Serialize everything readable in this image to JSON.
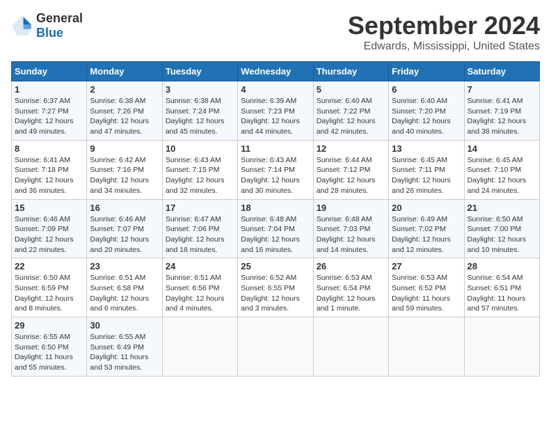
{
  "header": {
    "logo_general": "General",
    "logo_blue": "Blue",
    "month_title": "September 2024",
    "location": "Edwards, Mississippi, United States"
  },
  "days_of_week": [
    "Sunday",
    "Monday",
    "Tuesday",
    "Wednesday",
    "Thursday",
    "Friday",
    "Saturday"
  ],
  "weeks": [
    [
      {
        "day": "1",
        "sunrise": "6:37 AM",
        "sunset": "7:27 PM",
        "daylight": "12 hours and 49 minutes."
      },
      {
        "day": "2",
        "sunrise": "6:38 AM",
        "sunset": "7:26 PM",
        "daylight": "12 hours and 47 minutes."
      },
      {
        "day": "3",
        "sunrise": "6:38 AM",
        "sunset": "7:24 PM",
        "daylight": "12 hours and 45 minutes."
      },
      {
        "day": "4",
        "sunrise": "6:39 AM",
        "sunset": "7:23 PM",
        "daylight": "12 hours and 44 minutes."
      },
      {
        "day": "5",
        "sunrise": "6:40 AM",
        "sunset": "7:22 PM",
        "daylight": "12 hours and 42 minutes."
      },
      {
        "day": "6",
        "sunrise": "6:40 AM",
        "sunset": "7:20 PM",
        "daylight": "12 hours and 40 minutes."
      },
      {
        "day": "7",
        "sunrise": "6:41 AM",
        "sunset": "7:19 PM",
        "daylight": "12 hours and 38 minutes."
      }
    ],
    [
      {
        "day": "8",
        "sunrise": "6:41 AM",
        "sunset": "7:18 PM",
        "daylight": "12 hours and 36 minutes."
      },
      {
        "day": "9",
        "sunrise": "6:42 AM",
        "sunset": "7:16 PM",
        "daylight": "12 hours and 34 minutes."
      },
      {
        "day": "10",
        "sunrise": "6:43 AM",
        "sunset": "7:15 PM",
        "daylight": "12 hours and 32 minutes."
      },
      {
        "day": "11",
        "sunrise": "6:43 AM",
        "sunset": "7:14 PM",
        "daylight": "12 hours and 30 minutes."
      },
      {
        "day": "12",
        "sunrise": "6:44 AM",
        "sunset": "7:12 PM",
        "daylight": "12 hours and 28 minutes."
      },
      {
        "day": "13",
        "sunrise": "6:45 AM",
        "sunset": "7:11 PM",
        "daylight": "12 hours and 26 minutes."
      },
      {
        "day": "14",
        "sunrise": "6:45 AM",
        "sunset": "7:10 PM",
        "daylight": "12 hours and 24 minutes."
      }
    ],
    [
      {
        "day": "15",
        "sunrise": "6:46 AM",
        "sunset": "7:09 PM",
        "daylight": "12 hours and 22 minutes."
      },
      {
        "day": "16",
        "sunrise": "6:46 AM",
        "sunset": "7:07 PM",
        "daylight": "12 hours and 20 minutes."
      },
      {
        "day": "17",
        "sunrise": "6:47 AM",
        "sunset": "7:06 PM",
        "daylight": "12 hours and 18 minutes."
      },
      {
        "day": "18",
        "sunrise": "6:48 AM",
        "sunset": "7:04 PM",
        "daylight": "12 hours and 16 minutes."
      },
      {
        "day": "19",
        "sunrise": "6:48 AM",
        "sunset": "7:03 PM",
        "daylight": "12 hours and 14 minutes."
      },
      {
        "day": "20",
        "sunrise": "6:49 AM",
        "sunset": "7:02 PM",
        "daylight": "12 hours and 12 minutes."
      },
      {
        "day": "21",
        "sunrise": "6:50 AM",
        "sunset": "7:00 PM",
        "daylight": "12 hours and 10 minutes."
      }
    ],
    [
      {
        "day": "22",
        "sunrise": "6:50 AM",
        "sunset": "6:59 PM",
        "daylight": "12 hours and 8 minutes."
      },
      {
        "day": "23",
        "sunrise": "6:51 AM",
        "sunset": "6:58 PM",
        "daylight": "12 hours and 6 minutes."
      },
      {
        "day": "24",
        "sunrise": "6:51 AM",
        "sunset": "6:56 PM",
        "daylight": "12 hours and 4 minutes."
      },
      {
        "day": "25",
        "sunrise": "6:52 AM",
        "sunset": "6:55 PM",
        "daylight": "12 hours and 3 minutes."
      },
      {
        "day": "26",
        "sunrise": "6:53 AM",
        "sunset": "6:54 PM",
        "daylight": "12 hours and 1 minute."
      },
      {
        "day": "27",
        "sunrise": "6:53 AM",
        "sunset": "6:52 PM",
        "daylight": "11 hours and 59 minutes."
      },
      {
        "day": "28",
        "sunrise": "6:54 AM",
        "sunset": "6:51 PM",
        "daylight": "11 hours and 57 minutes."
      }
    ],
    [
      {
        "day": "29",
        "sunrise": "6:55 AM",
        "sunset": "6:50 PM",
        "daylight": "11 hours and 55 minutes."
      },
      {
        "day": "30",
        "sunrise": "6:55 AM",
        "sunset": "6:49 PM",
        "daylight": "11 hours and 53 minutes."
      },
      null,
      null,
      null,
      null,
      null
    ]
  ]
}
